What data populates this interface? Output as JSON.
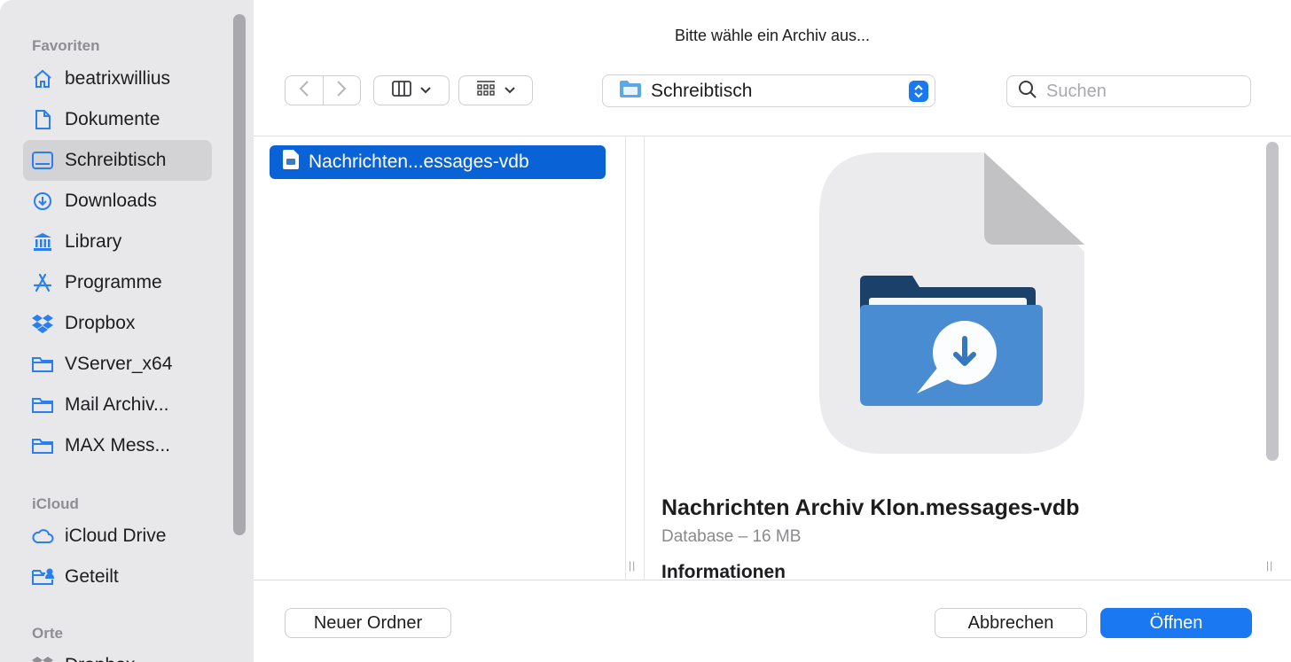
{
  "dialog": {
    "title": "Bitte wähle ein Archiv aus..."
  },
  "sidebar": {
    "sections": [
      {
        "label": "Favoriten"
      },
      {
        "label": "iCloud"
      },
      {
        "label": "Orte"
      }
    ],
    "items": [
      {
        "label": "beatrixwillius",
        "icon": "home-icon"
      },
      {
        "label": "Dokumente",
        "icon": "document-icon"
      },
      {
        "label": "Schreibtisch",
        "icon": "desktop-icon",
        "selected": true
      },
      {
        "label": "Downloads",
        "icon": "download-circle-icon"
      },
      {
        "label": "Library",
        "icon": "library-icon"
      },
      {
        "label": "Programme",
        "icon": "applications-icon"
      },
      {
        "label": "Dropbox",
        "icon": "dropbox-icon"
      },
      {
        "label": "VServer_x64",
        "icon": "folder-icon"
      },
      {
        "label": "Mail Archiv...",
        "icon": "folder-icon"
      },
      {
        "label": "MAX Mess...",
        "icon": "folder-icon"
      },
      {
        "label": "iCloud Drive",
        "icon": "cloud-icon"
      },
      {
        "label": "Geteilt",
        "icon": "shared-folder-icon"
      },
      {
        "label": "Dropbox",
        "icon": "dropbox-icon"
      }
    ]
  },
  "toolbar": {
    "location": "Schreibtisch",
    "search_placeholder": "Suchen"
  },
  "browser": {
    "selected_file": "Nachrichten...essages-vdb"
  },
  "preview": {
    "name": "Nachrichten Archiv Klon.messages-vdb",
    "kind": "Database – 16 MB",
    "info_heading": "Informationen"
  },
  "footer": {
    "new_folder": "Neuer Ordner",
    "cancel": "Abbrechen",
    "open": "Öffnen"
  },
  "colors": {
    "accent": "#1a78f2",
    "selection": "#0a62d7",
    "sidebar_bg": "#e8e7ea"
  }
}
